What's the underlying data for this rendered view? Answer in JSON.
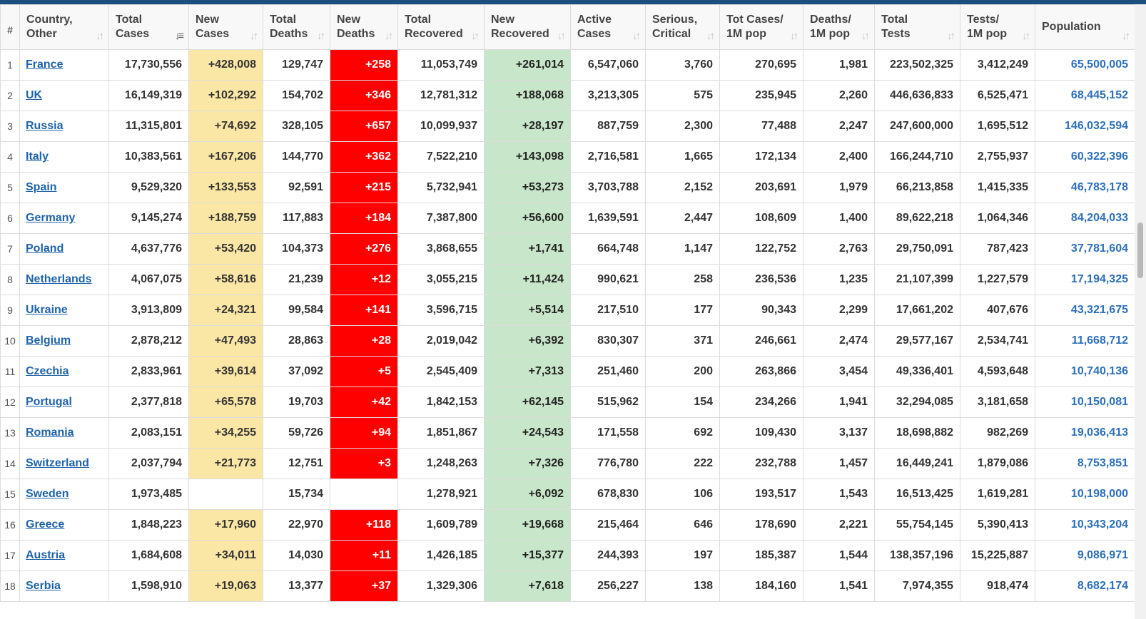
{
  "colors": {
    "header_bar": "#1d4f7d",
    "new_cases_bg": "#fbe7a5",
    "new_deaths_bg": "#ff0000",
    "new_recovered_bg": "#c8e6c9",
    "link": "#1f63a8",
    "population_text": "#2c6fbb"
  },
  "columns": [
    {
      "line1": "#",
      "line2": ""
    },
    {
      "line1": "Country,",
      "line2": "Other"
    },
    {
      "line1": "Total",
      "line2": "Cases"
    },
    {
      "line1": "New",
      "line2": "Cases"
    },
    {
      "line1": "Total",
      "line2": "Deaths"
    },
    {
      "line1": "New",
      "line2": "Deaths"
    },
    {
      "line1": "Total",
      "line2": "Recovered"
    },
    {
      "line1": "New",
      "line2": "Recovered"
    },
    {
      "line1": "Active",
      "line2": "Cases"
    },
    {
      "line1": "Serious,",
      "line2": "Critical"
    },
    {
      "line1": "Tot Cases/",
      "line2": "1M pop"
    },
    {
      "line1": "Deaths/",
      "line2": "1M pop"
    },
    {
      "line1": "Total",
      "line2": "Tests"
    },
    {
      "line1": "Tests/",
      "line2": "1M pop"
    },
    {
      "line1": "Population",
      "line2": ""
    }
  ],
  "sort_icons": {
    "inactive": "sort-updown-icon",
    "active": "sort-descending-icon",
    "active_column": 2
  },
  "rows": [
    {
      "idx": "1",
      "country": "France",
      "total_cases": "17,730,556",
      "new_cases": "+428,008",
      "total_deaths": "129,747",
      "new_deaths": "+258",
      "total_recovered": "11,053,749",
      "new_recovered": "+261,014",
      "active_cases": "6,547,060",
      "serious": "3,760",
      "cases_per_1m": "270,695",
      "deaths_per_1m": "1,981",
      "total_tests": "223,502,325",
      "tests_per_1m": "3,412,249",
      "population": "65,500,005"
    },
    {
      "idx": "2",
      "country": "UK",
      "total_cases": "16,149,319",
      "new_cases": "+102,292",
      "total_deaths": "154,702",
      "new_deaths": "+346",
      "total_recovered": "12,781,312",
      "new_recovered": "+188,068",
      "active_cases": "3,213,305",
      "serious": "575",
      "cases_per_1m": "235,945",
      "deaths_per_1m": "2,260",
      "total_tests": "446,636,833",
      "tests_per_1m": "6,525,471",
      "population": "68,445,152"
    },
    {
      "idx": "3",
      "country": "Russia",
      "total_cases": "11,315,801",
      "new_cases": "+74,692",
      "total_deaths": "328,105",
      "new_deaths": "+657",
      "total_recovered": "10,099,937",
      "new_recovered": "+28,197",
      "active_cases": "887,759",
      "serious": "2,300",
      "cases_per_1m": "77,488",
      "deaths_per_1m": "2,247",
      "total_tests": "247,600,000",
      "tests_per_1m": "1,695,512",
      "population": "146,032,594"
    },
    {
      "idx": "4",
      "country": "Italy",
      "total_cases": "10,383,561",
      "new_cases": "+167,206",
      "total_deaths": "144,770",
      "new_deaths": "+362",
      "total_recovered": "7,522,210",
      "new_recovered": "+143,098",
      "active_cases": "2,716,581",
      "serious": "1,665",
      "cases_per_1m": "172,134",
      "deaths_per_1m": "2,400",
      "total_tests": "166,244,710",
      "tests_per_1m": "2,755,937",
      "population": "60,322,396"
    },
    {
      "idx": "5",
      "country": "Spain",
      "total_cases": "9,529,320",
      "new_cases": "+133,553",
      "total_deaths": "92,591",
      "new_deaths": "+215",
      "total_recovered": "5,732,941",
      "new_recovered": "+53,273",
      "active_cases": "3,703,788",
      "serious": "2,152",
      "cases_per_1m": "203,691",
      "deaths_per_1m": "1,979",
      "total_tests": "66,213,858",
      "tests_per_1m": "1,415,335",
      "population": "46,783,178"
    },
    {
      "idx": "6",
      "country": "Germany",
      "total_cases": "9,145,274",
      "new_cases": "+188,759",
      "total_deaths": "117,883",
      "new_deaths": "+184",
      "total_recovered": "7,387,800",
      "new_recovered": "+56,600",
      "active_cases": "1,639,591",
      "serious": "2,447",
      "cases_per_1m": "108,609",
      "deaths_per_1m": "1,400",
      "total_tests": "89,622,218",
      "tests_per_1m": "1,064,346",
      "population": "84,204,033"
    },
    {
      "idx": "7",
      "country": "Poland",
      "total_cases": "4,637,776",
      "new_cases": "+53,420",
      "total_deaths": "104,373",
      "new_deaths": "+276",
      "total_recovered": "3,868,655",
      "new_recovered": "+1,741",
      "active_cases": "664,748",
      "serious": "1,147",
      "cases_per_1m": "122,752",
      "deaths_per_1m": "2,763",
      "total_tests": "29,750,091",
      "tests_per_1m": "787,423",
      "population": "37,781,604"
    },
    {
      "idx": "8",
      "country": "Netherlands",
      "total_cases": "4,067,075",
      "new_cases": "+58,616",
      "total_deaths": "21,239",
      "new_deaths": "+12",
      "total_recovered": "3,055,215",
      "new_recovered": "+11,424",
      "active_cases": "990,621",
      "serious": "258",
      "cases_per_1m": "236,536",
      "deaths_per_1m": "1,235",
      "total_tests": "21,107,399",
      "tests_per_1m": "1,227,579",
      "population": "17,194,325"
    },
    {
      "idx": "9",
      "country": "Ukraine",
      "total_cases": "3,913,809",
      "new_cases": "+24,321",
      "total_deaths": "99,584",
      "new_deaths": "+141",
      "total_recovered": "3,596,715",
      "new_recovered": "+5,514",
      "active_cases": "217,510",
      "serious": "177",
      "cases_per_1m": "90,343",
      "deaths_per_1m": "2,299",
      "total_tests": "17,661,202",
      "tests_per_1m": "407,676",
      "population": "43,321,675"
    },
    {
      "idx": "10",
      "country": "Belgium",
      "total_cases": "2,878,212",
      "new_cases": "+47,493",
      "total_deaths": "28,863",
      "new_deaths": "+28",
      "total_recovered": "2,019,042",
      "new_recovered": "+6,392",
      "active_cases": "830,307",
      "serious": "371",
      "cases_per_1m": "246,661",
      "deaths_per_1m": "2,474",
      "total_tests": "29,577,167",
      "tests_per_1m": "2,534,741",
      "population": "11,668,712"
    },
    {
      "idx": "11",
      "country": "Czechia",
      "total_cases": "2,833,961",
      "new_cases": "+39,614",
      "total_deaths": "37,092",
      "new_deaths": "+5",
      "total_recovered": "2,545,409",
      "new_recovered": "+7,313",
      "active_cases": "251,460",
      "serious": "200",
      "cases_per_1m": "263,866",
      "deaths_per_1m": "3,454",
      "total_tests": "49,336,401",
      "tests_per_1m": "4,593,648",
      "population": "10,740,136"
    },
    {
      "idx": "12",
      "country": "Portugal",
      "total_cases": "2,377,818",
      "new_cases": "+65,578",
      "total_deaths": "19,703",
      "new_deaths": "+42",
      "total_recovered": "1,842,153",
      "new_recovered": "+62,145",
      "active_cases": "515,962",
      "serious": "154",
      "cases_per_1m": "234,266",
      "deaths_per_1m": "1,941",
      "total_tests": "32,294,085",
      "tests_per_1m": "3,181,658",
      "population": "10,150,081"
    },
    {
      "idx": "13",
      "country": "Romania",
      "total_cases": "2,083,151",
      "new_cases": "+34,255",
      "total_deaths": "59,726",
      "new_deaths": "+94",
      "total_recovered": "1,851,867",
      "new_recovered": "+24,543",
      "active_cases": "171,558",
      "serious": "692",
      "cases_per_1m": "109,430",
      "deaths_per_1m": "3,137",
      "total_tests": "18,698,882",
      "tests_per_1m": "982,269",
      "population": "19,036,413"
    },
    {
      "idx": "14",
      "country": "Switzerland",
      "total_cases": "2,037,794",
      "new_cases": "+21,773",
      "total_deaths": "12,751",
      "new_deaths": "+3",
      "total_recovered": "1,248,263",
      "new_recovered": "+7,326",
      "active_cases": "776,780",
      "serious": "222",
      "cases_per_1m": "232,788",
      "deaths_per_1m": "1,457",
      "total_tests": "16,449,241",
      "tests_per_1m": "1,879,086",
      "population": "8,753,851"
    },
    {
      "idx": "15",
      "country": "Sweden",
      "total_cases": "1,973,485",
      "new_cases": "",
      "total_deaths": "15,734",
      "new_deaths": "",
      "total_recovered": "1,278,921",
      "new_recovered": "+6,092",
      "active_cases": "678,830",
      "serious": "106",
      "cases_per_1m": "193,517",
      "deaths_per_1m": "1,543",
      "total_tests": "16,513,425",
      "tests_per_1m": "1,619,281",
      "population": "10,198,000"
    },
    {
      "idx": "16",
      "country": "Greece",
      "total_cases": "1,848,223",
      "new_cases": "+17,960",
      "total_deaths": "22,970",
      "new_deaths": "+118",
      "total_recovered": "1,609,789",
      "new_recovered": "+19,668",
      "active_cases": "215,464",
      "serious": "646",
      "cases_per_1m": "178,690",
      "deaths_per_1m": "2,221",
      "total_tests": "55,754,145",
      "tests_per_1m": "5,390,413",
      "population": "10,343,204"
    },
    {
      "idx": "17",
      "country": "Austria",
      "total_cases": "1,684,608",
      "new_cases": "+34,011",
      "total_deaths": "14,030",
      "new_deaths": "+11",
      "total_recovered": "1,426,185",
      "new_recovered": "+15,377",
      "active_cases": "244,393",
      "serious": "197",
      "cases_per_1m": "185,387",
      "deaths_per_1m": "1,544",
      "total_tests": "138,357,196",
      "tests_per_1m": "15,225,887",
      "population": "9,086,971"
    },
    {
      "idx": "18",
      "country": "Serbia",
      "total_cases": "1,598,910",
      "new_cases": "+19,063",
      "total_deaths": "13,377",
      "new_deaths": "+37",
      "total_recovered": "1,329,306",
      "new_recovered": "+7,618",
      "active_cases": "256,227",
      "serious": "138",
      "cases_per_1m": "184,160",
      "deaths_per_1m": "1,541",
      "total_tests": "7,974,355",
      "tests_per_1m": "918,474",
      "population": "8,682,174"
    }
  ]
}
